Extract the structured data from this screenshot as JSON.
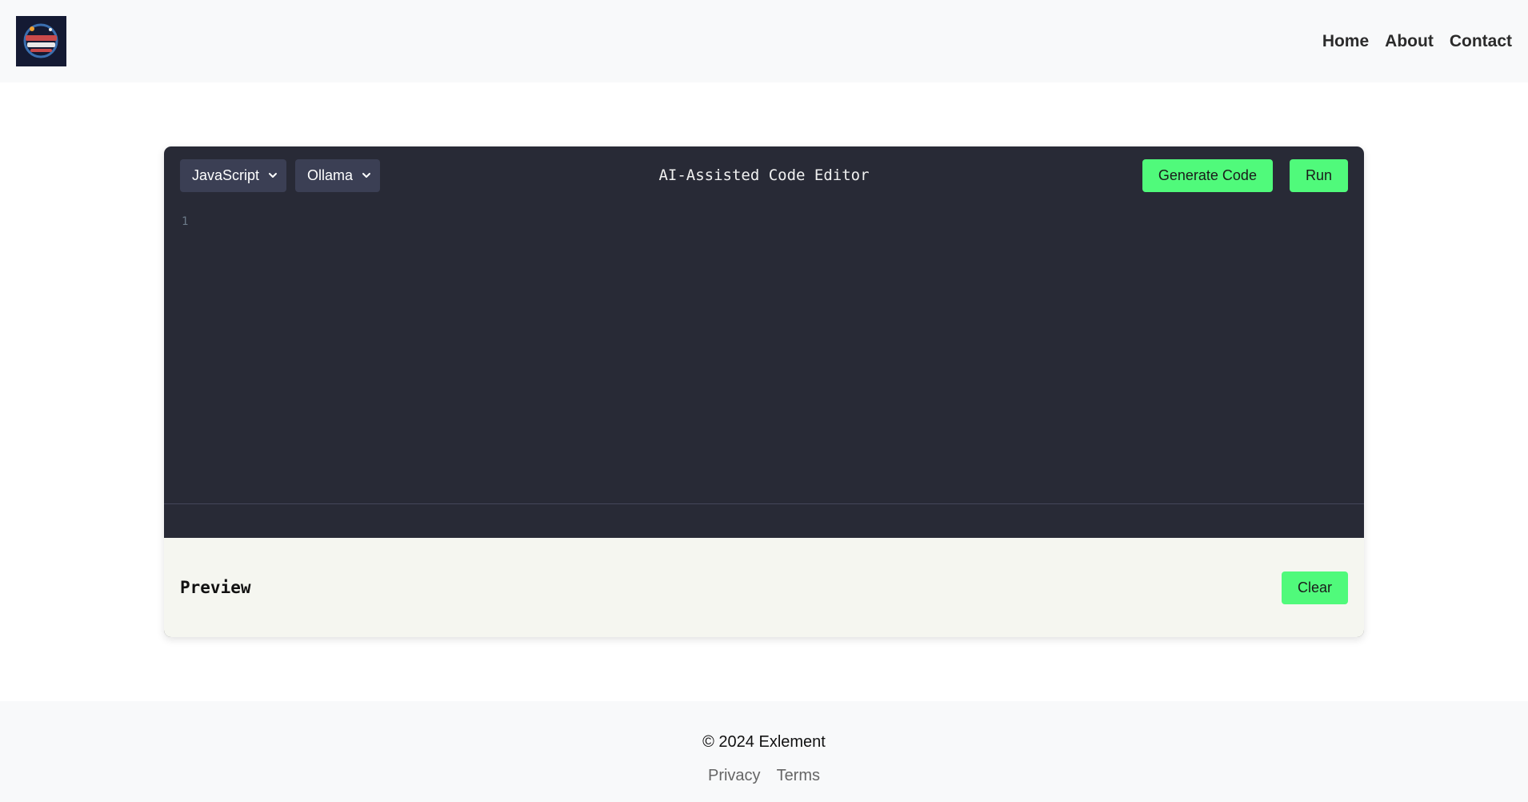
{
  "header": {
    "logo_icon": "exlement-logo",
    "nav": [
      {
        "label": "Home"
      },
      {
        "label": "About"
      },
      {
        "label": "Contact"
      }
    ]
  },
  "editor": {
    "title": "AI-Assisted Code Editor",
    "language_select": {
      "value": "JavaScript"
    },
    "model_select": {
      "value": "Ollama"
    },
    "generate_label": "Generate Code",
    "run_label": "Run",
    "line_numbers": [
      "1"
    ],
    "colors": {
      "background": "#282a36",
      "accent": "#50fa7b",
      "select_bg": "#3b3f54"
    }
  },
  "preview": {
    "title": "Preview",
    "clear_label": "Clear"
  },
  "footer": {
    "copyright": "© 2024 Exlement",
    "links": [
      {
        "label": "Privacy"
      },
      {
        "label": "Terms"
      }
    ]
  }
}
